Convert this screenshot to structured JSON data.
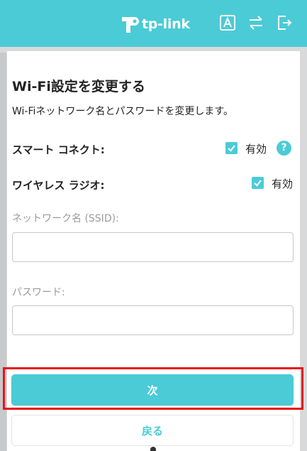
{
  "header": {
    "logo_text": "tp-link",
    "icons": [
      "font-icon",
      "swap-icon",
      "logout-icon"
    ],
    "colors": {
      "accent": "#4acbd6",
      "highlight": "#e8141b"
    }
  },
  "page": {
    "title": "Wi-Fi設定を変更する",
    "description": "Wi-Fiネットワーク名とパスワードを変更します。"
  },
  "smart_connect": {
    "label": "スマート コネクト:",
    "checkbox_label": "有効",
    "checked": true,
    "help": "?"
  },
  "wireless_radio": {
    "label": "ワイヤレス ラジオ:",
    "checkbox_label": "有効",
    "checked": true
  },
  "ssid": {
    "label": "ネットワーク名 (SSID):",
    "value": "",
    "placeholder": ""
  },
  "password": {
    "label": "パスワード:",
    "value": "",
    "placeholder": ""
  },
  "buttons": {
    "next": "次",
    "back": "戻る"
  }
}
